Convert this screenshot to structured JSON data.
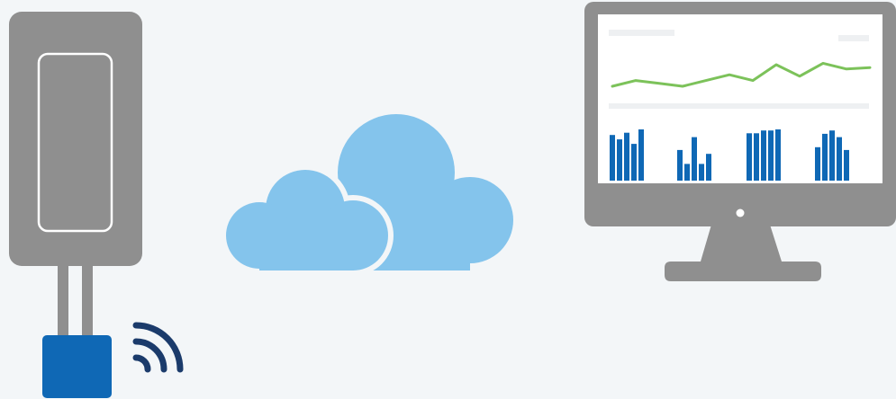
{
  "colors": {
    "background": "#f3f6f8",
    "device_gray": "#8f8f8f",
    "device_outline": "#ffffff",
    "sensor_blue": "#0f68b5",
    "signal_navy": "#1b3b6b",
    "cloud_blue": "#84c4ec",
    "monitor_gray": "#8f8f8f",
    "screen_white": "#ffffff",
    "placeholder_gray": "#eef0f2",
    "line_green": "#7cc25a",
    "bar_blue": "#0f68b5"
  },
  "icons": {
    "gateway": "gateway-device-icon",
    "sensor": "sensor-probe-icon",
    "wireless": "wireless-signal-icon",
    "cloud": "cloud-icon",
    "monitor": "monitor-dashboard-icon"
  },
  "chart_data": [
    {
      "type": "line",
      "x": [
        1,
        2,
        3,
        4,
        5,
        6,
        7,
        8,
        9,
        10,
        11,
        12
      ],
      "values": [
        30,
        38,
        34,
        30,
        38,
        46,
        38,
        60,
        44,
        62,
        54,
        56
      ],
      "ylim": [
        0,
        100
      ]
    },
    {
      "type": "bar",
      "groups": [
        [
          82,
          74,
          86,
          66,
          92
        ],
        [
          55,
          30,
          78,
          30,
          48
        ],
        [
          85,
          85,
          90,
          90,
          92
        ],
        [
          60,
          84,
          90,
          78,
          55
        ]
      ],
      "ylim": [
        0,
        100
      ]
    }
  ]
}
